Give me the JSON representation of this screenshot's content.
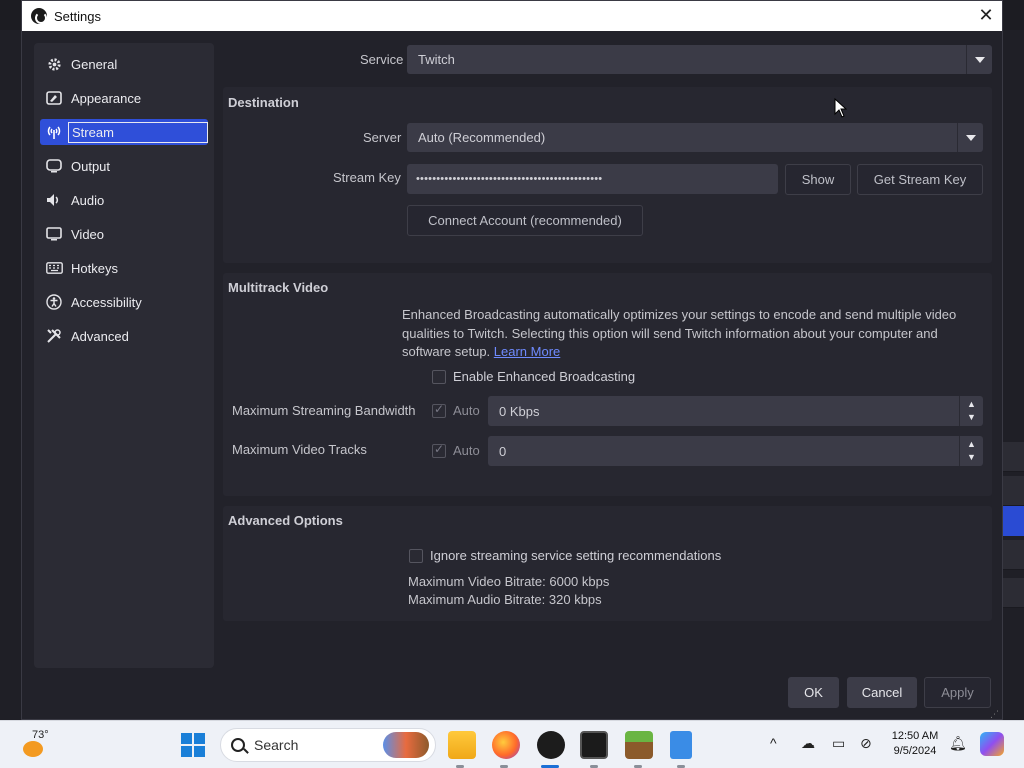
{
  "window": {
    "title": "Settings"
  },
  "sidebar": {
    "items": [
      {
        "label": "General",
        "icon": "gear-icon"
      },
      {
        "label": "Appearance",
        "icon": "appearance-icon"
      },
      {
        "label": "Stream",
        "icon": "antenna-icon",
        "active": true
      },
      {
        "label": "Output",
        "icon": "output-icon"
      },
      {
        "label": "Audio",
        "icon": "speaker-icon"
      },
      {
        "label": "Video",
        "icon": "monitor-icon"
      },
      {
        "label": "Hotkeys",
        "icon": "keyboard-icon"
      },
      {
        "label": "Accessibility",
        "icon": "accessibility-icon"
      },
      {
        "label": "Advanced",
        "icon": "tools-icon"
      }
    ]
  },
  "service": {
    "label": "Service",
    "value": "Twitch"
  },
  "destination": {
    "title": "Destination",
    "server_label": "Server",
    "server_value": "Auto (Recommended)",
    "stream_key_label": "Stream Key",
    "stream_key_value": "••••••••••••••••••••••••••••••••••••••••••••••",
    "show_button": "Show",
    "get_key_button": "Get Stream Key",
    "connect_button": "Connect Account (recommended)"
  },
  "multitrack": {
    "title": "Multitrack Video",
    "description": "Enhanced Broadcasting automatically optimizes your settings to encode and send multiple video qualities to Twitch. Selecting this option will send Twitch information about your computer and software setup.",
    "learn_more": "Learn More",
    "enable_label": "Enable Enhanced Broadcasting",
    "enable_checked": false,
    "bandwidth_label": "Maximum Streaming Bandwidth",
    "bandwidth_auto_label": "Auto",
    "bandwidth_auto_checked": true,
    "bandwidth_value": "0 Kbps",
    "tracks_label": "Maximum Video Tracks",
    "tracks_auto_label": "Auto",
    "tracks_auto_checked": true,
    "tracks_value": "0"
  },
  "advanced": {
    "title": "Advanced Options",
    "ignore_label": "Ignore streaming service setting recommendations",
    "ignore_checked": false,
    "max_video_bitrate": "Maximum Video Bitrate: 6000 kbps",
    "max_audio_bitrate": "Maximum Audio Bitrate: 320 kbps"
  },
  "footer": {
    "ok": "OK",
    "cancel": "Cancel",
    "apply": "Apply"
  },
  "taskbar": {
    "temperature": "73°",
    "search_placeholder": "Search",
    "time": "12:50 AM",
    "date": "9/5/2024"
  },
  "colors": {
    "accent": "#2f4fd9",
    "link": "#6f8bff",
    "dialog_bg": "#22222a",
    "section_bg": "#272730"
  }
}
